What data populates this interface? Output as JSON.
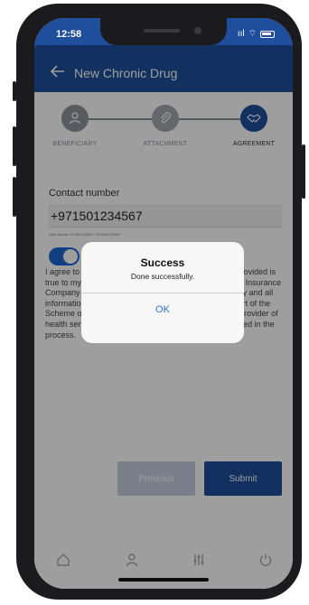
{
  "status": {
    "time": "12:58",
    "signal": "ııl",
    "wifi": "⌔"
  },
  "header": {
    "title": "New Chronic Drug",
    "back_icon": "arrow-left-icon"
  },
  "steps": [
    {
      "label": "BENEFICIARY",
      "icon": "person-icon",
      "active": false
    },
    {
      "label": "ATTACHMENT",
      "icon": "paperclip-icon",
      "active": false
    },
    {
      "label": "AGREEMENT",
      "icon": "handshake-icon",
      "active": true
    }
  ],
  "form": {
    "contact_label": "Contact number",
    "contact_value": "+971501234567",
    "contact_hint": "Valid format: 971501234567 / 971501234567",
    "agreement_text": "I agree to the terms & conditions and the information provided is true to my knowledge and belief. I hereby authorize the Insurance Company or its authorized representatives to obtain any and all information submitted to the Insurance Company as part of the Scheme or medical history from any hospital, clinic or provider of health services whenever any sort of clarification required in the process.",
    "agreed": true
  },
  "buttons": {
    "previous": "Previous",
    "submit": "Submit"
  },
  "nav": [
    "home-icon",
    "profile-icon",
    "settings-sliders-icon",
    "power-icon"
  ],
  "dialog": {
    "title": "Success",
    "message": "Done successfully.",
    "ok": "OK"
  },
  "colors": {
    "primary": "#1e4e9c",
    "accent": "#1e64d2",
    "link": "#2e6fd6"
  }
}
